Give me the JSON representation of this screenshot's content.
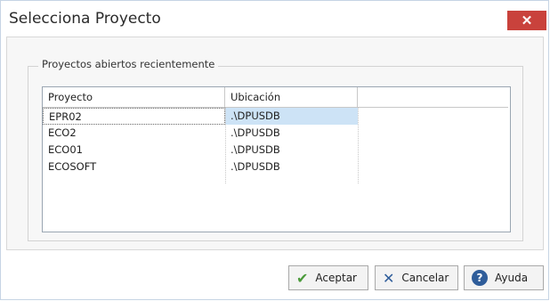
{
  "window": {
    "title": "Selecciona Proyecto",
    "close_glyph": "✕"
  },
  "group": {
    "legend": "Proyectos abiertos recientemente"
  },
  "grid": {
    "columns": [
      "Proyecto",
      "Ubicación",
      ""
    ],
    "rows": [
      {
        "proyecto": "EPR02",
        "ubicacion": ".\\DPUSDB",
        "selected": true
      },
      {
        "proyecto": "ECO2",
        "ubicacion": ".\\DPUSDB",
        "selected": false
      },
      {
        "proyecto": "ECO01",
        "ubicacion": ".\\DPUSDB",
        "selected": false
      },
      {
        "proyecto": "ECOSOFT",
        "ubicacion": ".\\DPUSDB",
        "selected": false
      }
    ]
  },
  "buttons": {
    "accept_label": "Aceptar",
    "cancel_label": "Cancelar",
    "help_label": "Ayuda"
  },
  "icons": {
    "accept": "check-icon",
    "cancel": "x-icon",
    "help": "help-icon"
  },
  "colors": {
    "close_bg": "#c9423c",
    "selection": "#cde3f6",
    "accept_icon": "#4a9a3a",
    "action_icon": "#2f5d9a"
  }
}
